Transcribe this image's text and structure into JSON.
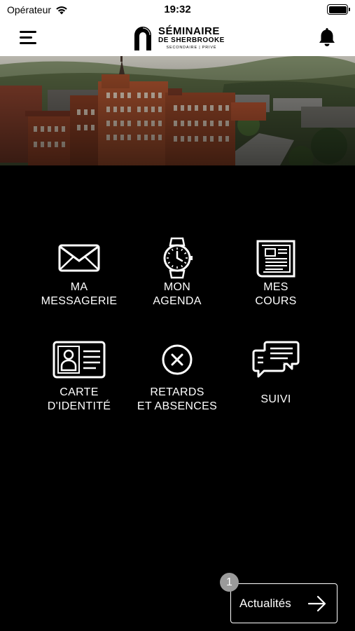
{
  "status_bar": {
    "carrier": "Opérateur",
    "time": "19:32"
  },
  "header": {
    "logo": {
      "line1": "SÉMINAIRE",
      "line2": "DE SHERBROOKE",
      "line3": "SECONDAIRE | PRIVÉ"
    }
  },
  "menu": {
    "items": [
      {
        "label": "MA\nMESSAGERIE",
        "icon": "envelope-icon"
      },
      {
        "label": "MON\nAGENDA",
        "icon": "watch-icon"
      },
      {
        "label": "MES\nCOURS",
        "icon": "newspaper-icon"
      },
      {
        "label": "CARTE\nD'IDENTITÉ",
        "icon": "id-card-icon"
      },
      {
        "label": "RETARDS\nET ABSENCES",
        "icon": "close-circle-icon"
      },
      {
        "label": "SUIVI",
        "icon": "chat-bubbles-icon"
      }
    ]
  },
  "news_button": {
    "label": "Actualités",
    "badge": "1"
  },
  "colors": {
    "background": "#000000",
    "header_bg": "#ffffff",
    "badge": "#9a9a9a"
  }
}
